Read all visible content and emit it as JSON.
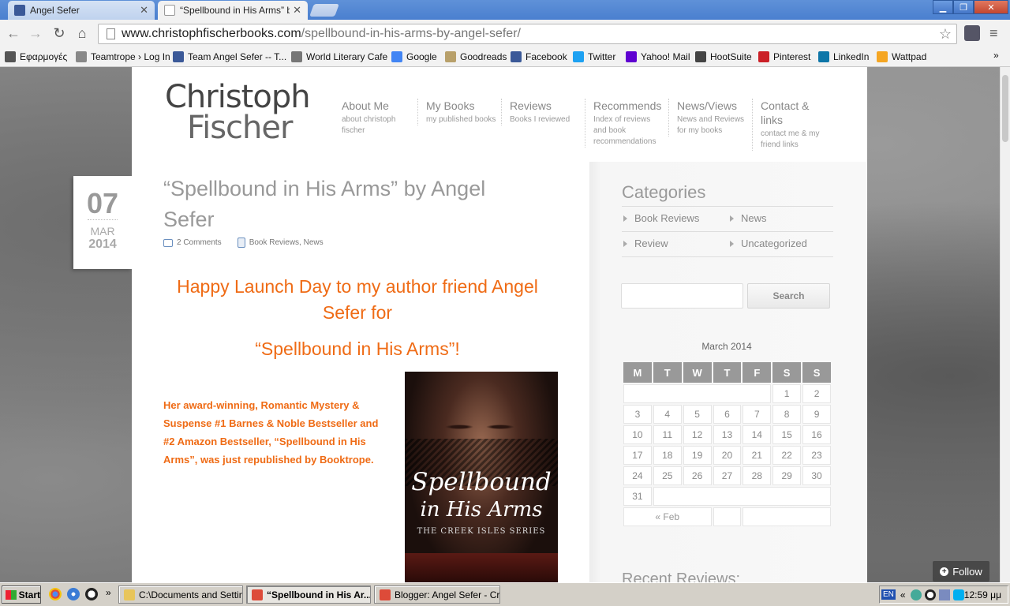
{
  "browser": {
    "tabs": [
      {
        "label": "Angel Sefer",
        "active": false
      },
      {
        "label": "“Spellbound in His Arms” by A",
        "active": true
      }
    ],
    "url_host": "www.christophfischerbooks.com",
    "url_path": "/spellbound-in-his-arms-by-angel-sefer/",
    "bookmarks": [
      {
        "label": "Εφαρμογές",
        "icon": "apps-icon",
        "color": "#555555"
      },
      {
        "label": "Teamtrope › Log In",
        "icon": "page-icon",
        "color": "#888888"
      },
      {
        "label": "Team Angel Sefer -- T...",
        "icon": "facebook-icon",
        "color": "#3b5998"
      },
      {
        "label": "World Literary Cafe",
        "icon": "wlc-icon",
        "color": "#777777"
      },
      {
        "label": "Google",
        "icon": "google-icon",
        "color": "#4285f4"
      },
      {
        "label": "Goodreads",
        "icon": "goodreads-icon",
        "color": "#b8a06a"
      },
      {
        "label": "Facebook",
        "icon": "facebook-icon",
        "color": "#3b5998"
      },
      {
        "label": "Twitter",
        "icon": "twitter-icon",
        "color": "#1da1f2"
      },
      {
        "label": "Yahoo! Mail",
        "icon": "yahoo-icon",
        "color": "#5f01d1"
      },
      {
        "label": "HootSuite",
        "icon": "hootsuite-icon",
        "color": "#444444"
      },
      {
        "label": "Pinterest",
        "icon": "pinterest-icon",
        "color": "#cb2027"
      },
      {
        "label": "LinkedIn",
        "icon": "linkedin-icon",
        "color": "#0e76a8"
      },
      {
        "label": "Wattpad",
        "icon": "wattpad-icon",
        "color": "#f5a623"
      }
    ],
    "bookmarks_overflow": "»"
  },
  "site": {
    "logo_line1": "Christoph",
    "logo_line2": "Fischer",
    "nav": [
      {
        "title": "About Me",
        "sub": "about christoph fischer"
      },
      {
        "title": "My Books",
        "sub": "my published books"
      },
      {
        "title": "Reviews",
        "sub": "Books I reviewed"
      },
      {
        "title": "Recommends",
        "sub": "Index of reviews and book recommendations"
      },
      {
        "title": "News/Views",
        "sub": "News and Reviews for my books"
      },
      {
        "title": "Contact & links",
        "sub": "contact me & my friend links"
      }
    ]
  },
  "post": {
    "date_day": "07",
    "date_month": "MAR",
    "date_year": "2014",
    "title": "“Spellbound in His Arms” by Angel Sefer",
    "comments": "2 Comments",
    "category1": "Book Reviews",
    "category_sep": ", ",
    "category2": "News",
    "launch_line": "Happy Launch Day to my author friend Angel Sefer for",
    "book_title_line": "“Spellbound in His Arms”!",
    "blurb": "Her award-winning, Romantic Mystery & Suspense #1 Barnes & Noble Bestseller and #2 Amazon Bestseller, “Spellbound in His Arms”, was just republished by Booktrope.",
    "cover_title1": "Spellbound",
    "cover_title2": "in His Arms",
    "cover_series": "THE CREEK ISLES SERIES",
    "accent_color": "#ef6b15"
  },
  "sidebar": {
    "categories_title": "Categories",
    "categories": [
      "Book Reviews",
      "News",
      "Review",
      "Uncategorized"
    ],
    "search_button": "Search",
    "search_placeholder": "",
    "calendar_caption": "March 2014",
    "weekdays": [
      "M",
      "T",
      "W",
      "T",
      "F",
      "S",
      "S"
    ],
    "weeks": [
      [
        "",
        "",
        "",
        "",
        "",
        "1",
        "2"
      ],
      [
        "3",
        "4",
        "5",
        "6",
        "7",
        "8",
        "9"
      ],
      [
        "10",
        "11",
        "12",
        "13",
        "14",
        "15",
        "16"
      ],
      [
        "17",
        "18",
        "19",
        "20",
        "21",
        "22",
        "23"
      ],
      [
        "24",
        "25",
        "26",
        "27",
        "28",
        "29",
        "30"
      ],
      [
        "31",
        "",
        "",
        "",
        "",
        "",
        ""
      ]
    ],
    "prev_month": "« Feb",
    "recent_title": "Recent Reviews:"
  },
  "follow_label": "Follow",
  "taskbar": {
    "start": "Start",
    "quicklaunch_overflow": "»",
    "tasks": [
      {
        "label": "C:\\Documents and Settin...",
        "icon": "folder-icon",
        "color": "#e8c55a",
        "active": false
      },
      {
        "label": "“Spellbound in His Ar...",
        "icon": "chrome-icon",
        "color": "#dd4b39",
        "active": true
      },
      {
        "label": "Blogger: Angel Sefer - Cr...",
        "icon": "chrome-icon",
        "color": "#dd4b39",
        "active": false
      }
    ],
    "lang": "EN",
    "tray_overflow": "«",
    "clock": "12:59 μμ"
  }
}
